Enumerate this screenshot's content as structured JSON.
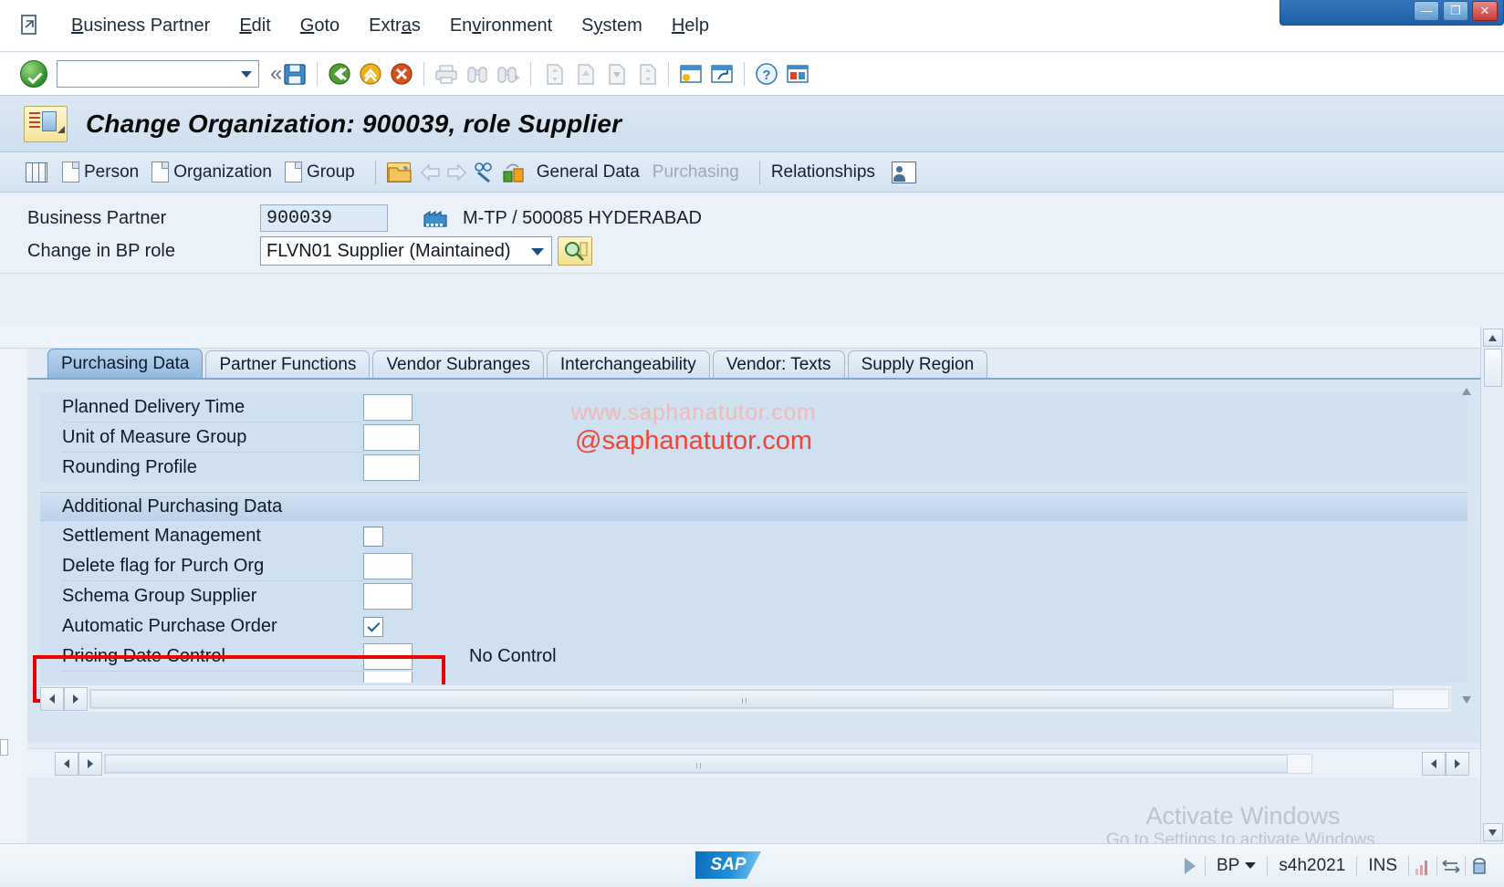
{
  "window": {
    "minimize_label": "—",
    "restore_label": "❐",
    "close_label": "✕"
  },
  "menu": {
    "system_icon": "exit-document-icon",
    "items": [
      {
        "label": "Business Partner",
        "accel": "B"
      },
      {
        "label": "Edit",
        "accel": "E"
      },
      {
        "label": "Goto",
        "accel": "G"
      },
      {
        "label": "Extras",
        "accel": "a"
      },
      {
        "label": "Environment",
        "accel": "v"
      },
      {
        "label": "System",
        "accel": "y"
      },
      {
        "label": "Help",
        "accel": "H"
      }
    ]
  },
  "toolbar": {
    "ok_icon": "green-check-icon",
    "command_field_value": "",
    "command_field_placeholder": "",
    "history_arrow_icon": "chevron-down-icon",
    "collapse_icon": "double-chevron-left-icon",
    "buttons": [
      {
        "name": "save-button",
        "icon": "save-floppy-icon",
        "enabled": true
      },
      {
        "name": "back-button",
        "icon": "green-back-arrow-icon",
        "enabled": true
      },
      {
        "name": "exit-button",
        "icon": "yellow-up-arrow-icon",
        "enabled": true
      },
      {
        "name": "cancel-button",
        "icon": "red-cancel-x-icon",
        "enabled": true
      },
      {
        "name": "print-button",
        "icon": "printer-icon",
        "enabled": false
      },
      {
        "name": "find-button",
        "icon": "binoculars-icon",
        "enabled": false
      },
      {
        "name": "find-next-button",
        "icon": "binoculars-plus-icon",
        "enabled": false
      },
      {
        "name": "first-page-button",
        "icon": "page-first-icon",
        "enabled": false
      },
      {
        "name": "previous-page-button",
        "icon": "page-up-icon",
        "enabled": false
      },
      {
        "name": "next-page-button",
        "icon": "page-down-icon",
        "enabled": false
      },
      {
        "name": "last-page-button",
        "icon": "page-last-icon",
        "enabled": false
      },
      {
        "name": "create-session-button",
        "icon": "new-session-icon",
        "enabled": true
      },
      {
        "name": "create-shortcut-button",
        "icon": "shortcut-icon",
        "enabled": true
      },
      {
        "name": "help-button",
        "icon": "question-mark-help-icon",
        "enabled": true
      },
      {
        "name": "layout-menu-button",
        "icon": "customize-local-layout-icon",
        "enabled": true
      }
    ]
  },
  "title": {
    "icon": "change-organization-icon",
    "text": "Change Organization: 900039, role Supplier"
  },
  "app_toolbar": {
    "items": [
      {
        "name": "list-view-button",
        "label": "",
        "icon": "grid-list-icon",
        "enabled": true
      },
      {
        "name": "person-button",
        "label": "Person",
        "icon": "document-icon",
        "enabled": true
      },
      {
        "name": "organization-button",
        "label": "Organization",
        "icon": "document-icon",
        "enabled": true
      },
      {
        "name": "group-button",
        "label": "Group",
        "icon": "document-icon",
        "enabled": true
      },
      {
        "name": "open-button",
        "label": "",
        "icon": "open-folder-icon",
        "enabled": true
      },
      {
        "name": "previous-button",
        "label": "",
        "icon": "left-arrow-icon",
        "enabled": false
      },
      {
        "name": "next-button",
        "label": "",
        "icon": "right-arrow-icon",
        "enabled": false
      },
      {
        "name": "display-change-button",
        "label": "",
        "icon": "glasses-pencil-icon",
        "enabled": true
      },
      {
        "name": "switch-view-button",
        "label": "",
        "icon": "org-switch-icon",
        "enabled": true
      },
      {
        "name": "general-data-button",
        "label": "General Data",
        "icon": "",
        "enabled": true
      },
      {
        "name": "purchasing-button",
        "label": "Purchasing",
        "icon": "",
        "enabled": false
      },
      {
        "name": "relationships-button",
        "label": "Relationships",
        "icon": "",
        "enabled": true
      },
      {
        "name": "person-card-button",
        "label": "",
        "icon": "person-card-icon",
        "enabled": true
      }
    ]
  },
  "header_form": {
    "business_partner_label": "Business Partner",
    "business_partner_value": "900039",
    "plant_icon": "plant-factory-icon",
    "plant_text": "M-TP / 500085 HYDERABAD",
    "bp_role_label": "Change in BP role",
    "bp_role_value": "FLVN01 Supplier (Maintained)",
    "bp_role_options": [
      "FLVN01 Supplier (Maintained)"
    ],
    "bp_role_search_icon": "search-magnifier-icon"
  },
  "tabs": [
    {
      "label": "Purchasing Data",
      "active": true
    },
    {
      "label": "Partner Functions",
      "active": false
    },
    {
      "label": "Vendor Subranges",
      "active": false
    },
    {
      "label": "Interchangeability",
      "active": false
    },
    {
      "label": "Vendor: Texts",
      "active": false
    },
    {
      "label": "Supply Region",
      "active": false
    }
  ],
  "purchasing_data": {
    "top_fields": [
      {
        "label": "Planned Delivery Time",
        "value": "",
        "type": "text"
      },
      {
        "label": "Unit of Measure Group",
        "value": "",
        "type": "text"
      },
      {
        "label": "Rounding Profile",
        "value": "",
        "type": "text"
      }
    ],
    "section_title": "Additional Purchasing Data",
    "section_fields": [
      {
        "label": "Settlement Management",
        "value": "",
        "type": "checkbox",
        "checked": false
      },
      {
        "label": "Delete flag for Purch Org",
        "value": "",
        "type": "text"
      },
      {
        "label": "Schema Group Supplier",
        "value": "",
        "type": "text"
      },
      {
        "label": "Automatic Purchase Order",
        "value": "",
        "type": "checkbox",
        "checked": true,
        "highlighted": true
      },
      {
        "label": "Pricing Date Control",
        "value": "No Control",
        "type": "text"
      }
    ]
  },
  "watermark": {
    "line1": "www.saphanatutor.com",
    "line2": "@saphanatutor.com"
  },
  "activate_windows": {
    "line1": "Activate Windows",
    "line2": "Go to Settings to activate Windows."
  },
  "status_bar": {
    "logo_text": "SAP",
    "servicing_icon": "play-triangle-icon",
    "transaction": "BP",
    "system": "s4h2021",
    "insert_mode": "INS",
    "signal_icon": "signal-bars-icon",
    "network_icon": "data-transfer-icon",
    "resize_icon": "resize-grip-icon"
  },
  "colors": {
    "accent": "#1b4f86",
    "highlight_red": "#e60000",
    "tab_active": "#93bade",
    "panel_bg": "#cfe0f0",
    "watermark_red": "#f44336"
  }
}
